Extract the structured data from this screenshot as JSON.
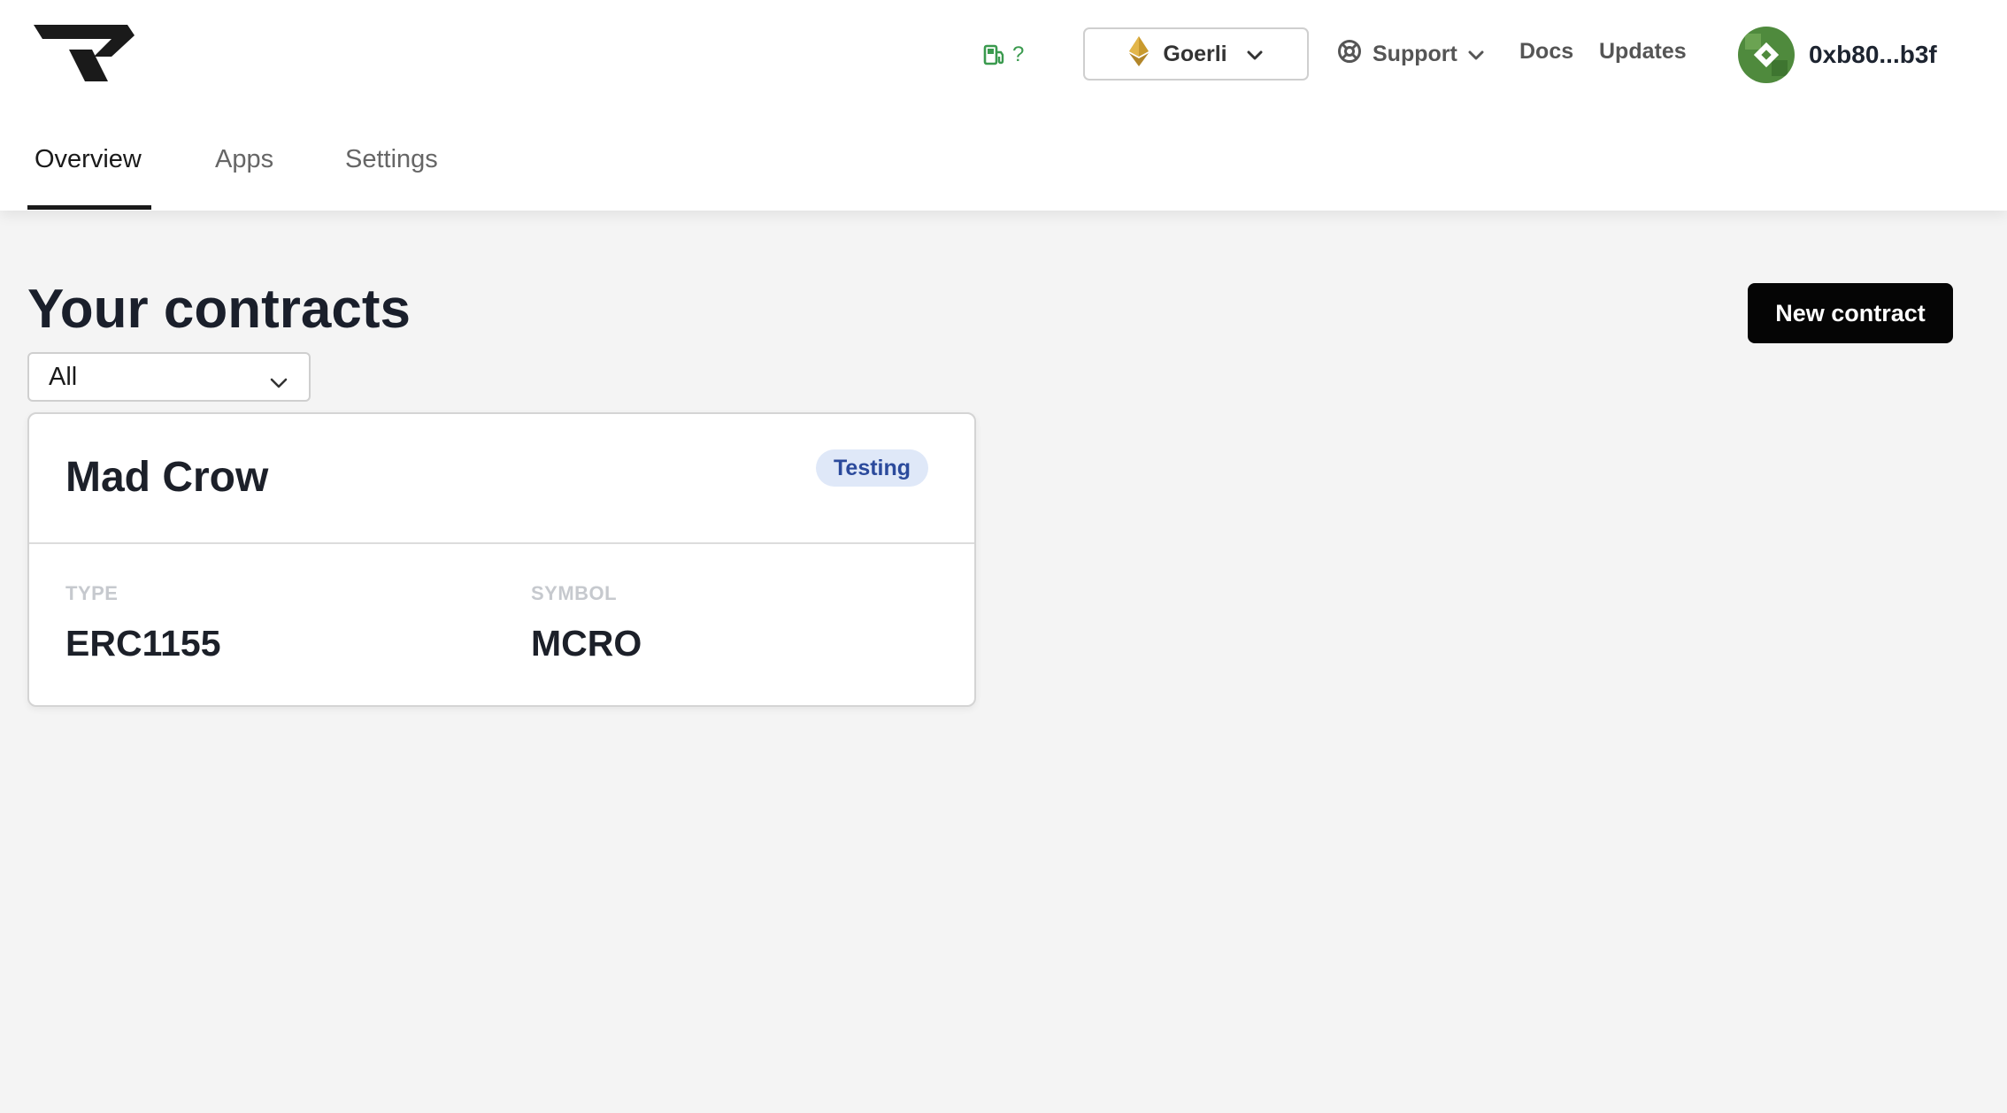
{
  "header": {
    "gas_price": "?",
    "network": {
      "name": "Goerli"
    },
    "nav": {
      "support": "Support",
      "docs": "Docs",
      "updates": "Updates"
    },
    "account": {
      "address": "0xb80...b3f"
    }
  },
  "tabs": [
    {
      "label": "Overview",
      "active": true
    },
    {
      "label": "Apps",
      "active": false
    },
    {
      "label": "Settings",
      "active": false
    }
  ],
  "main": {
    "title": "Your contracts",
    "new_contract_label": "New contract",
    "filter": {
      "selected": "All"
    },
    "contracts": [
      {
        "name": "Mad Crow",
        "status": "Testing",
        "type_label": "TYPE",
        "type_value": "ERC1155",
        "symbol_label": "SYMBOL",
        "symbol_value": "MCRO"
      }
    ]
  },
  "colors": {
    "page_background": "#f4f4f4",
    "primary_button": "#050505",
    "badge_background": "#dfe8f8",
    "badge_text": "#2b4a9c",
    "gas_icon": "#3a9a4e",
    "avatar": "#4f8a3d"
  },
  "icons": [
    "logo-icon",
    "gas-pump-icon",
    "ethereum-icon",
    "chevron-down-icon",
    "lifebuoy-icon",
    "avatar"
  ]
}
